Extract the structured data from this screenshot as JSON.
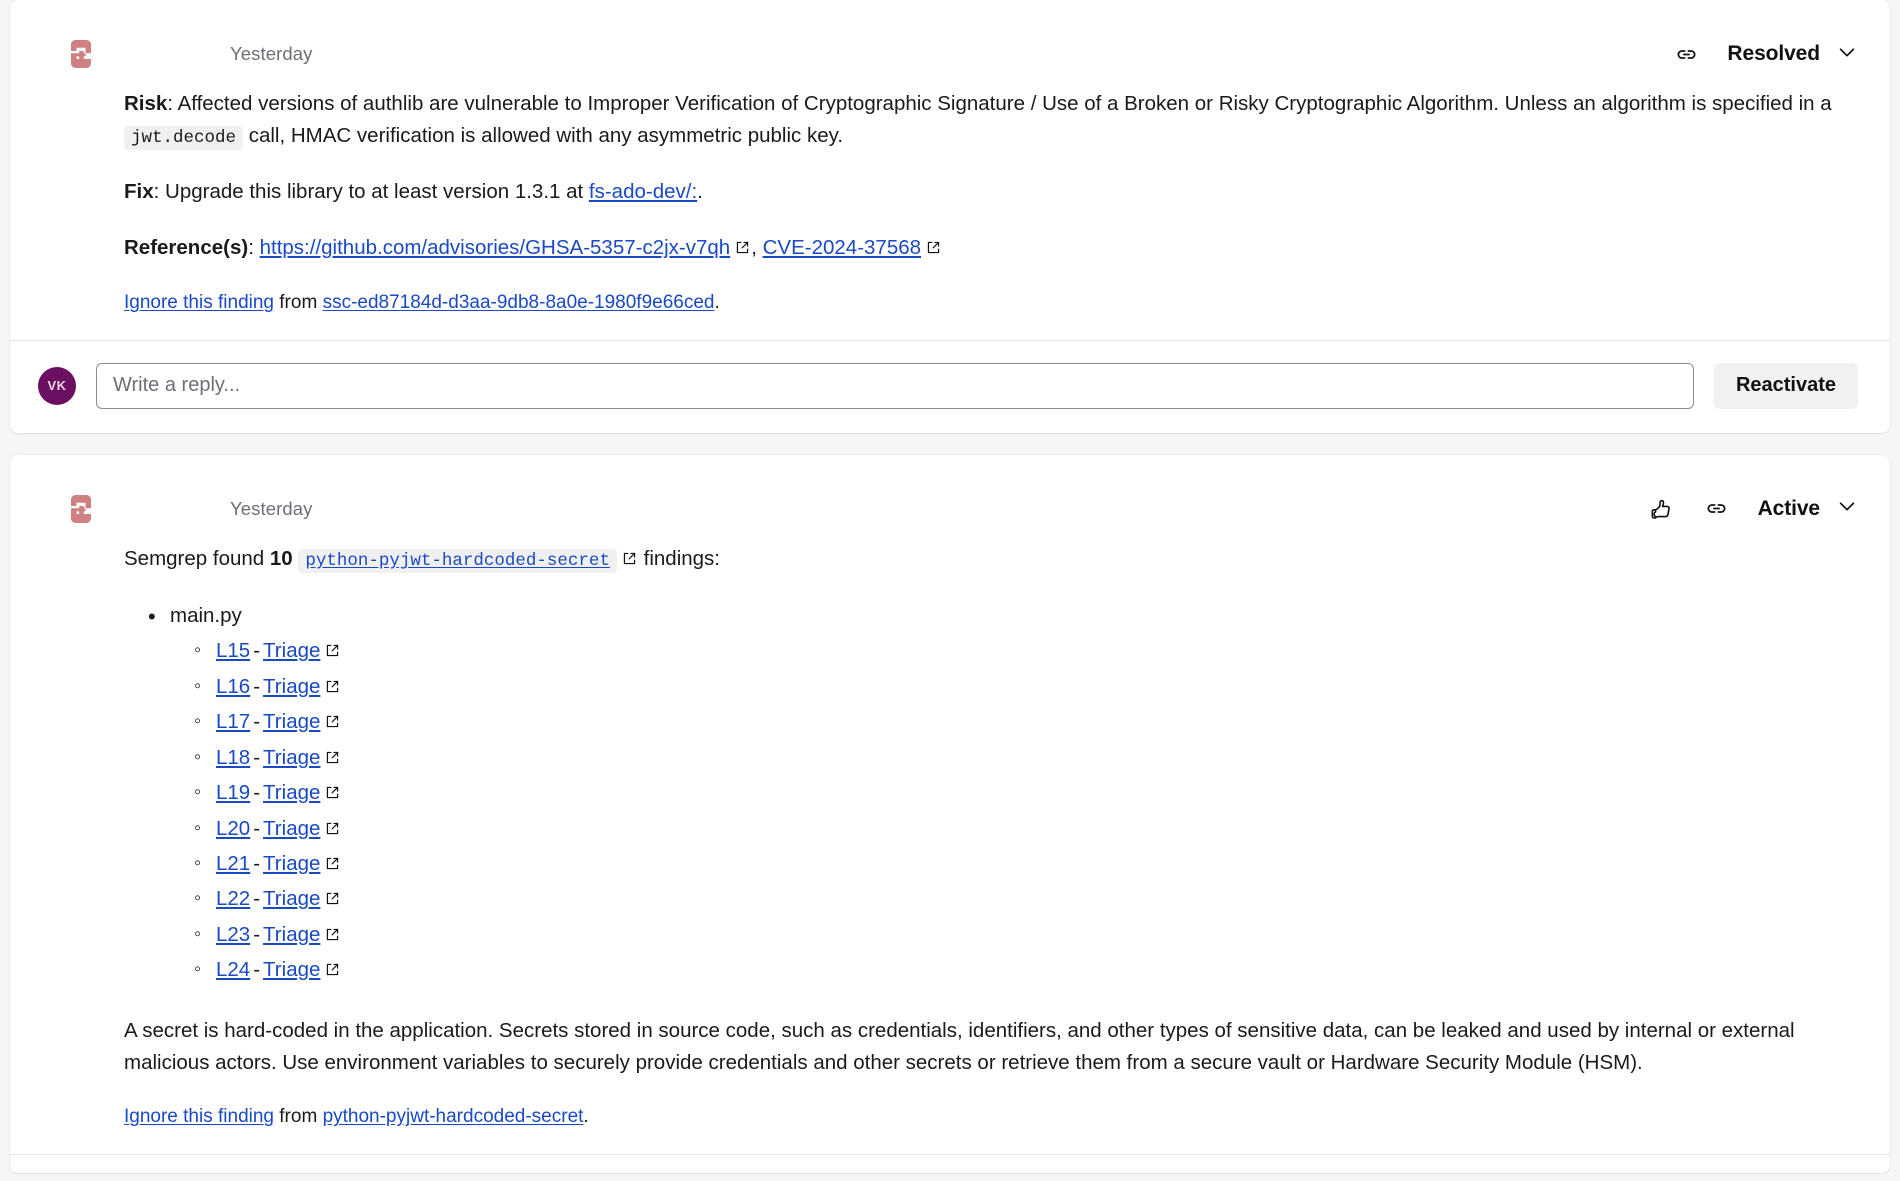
{
  "theme": {
    "page_bg": "#f6f6f7",
    "card_bg": "#ffffff",
    "link_color": "#1a49c4",
    "semgrep_avatar_color": "#cf8080",
    "user_avatar_color": "#6b1060",
    "button_bg": "#f1f1f2"
  },
  "comments": [
    {
      "avatar_icon": "semgrep-logo-icon",
      "timestamp": "Yesterday",
      "actions": {
        "link_icon": "link-icon",
        "status_label": "Resolved",
        "chevron_icon": "chevron-down-icon"
      },
      "risk": {
        "label": "Risk",
        "text_before_code": ": Affected versions of authlib are vulnerable to Improper Verification of Cryptographic Signature / Use of a Broken or Risky Cryptographic Algorithm. Unless an algorithm is specified in a ",
        "code": "jwt.decode",
        "text_after_code": " call, HMAC verification is allowed with any asymmetric public key."
      },
      "fix": {
        "label": "Fix",
        "text": ": Upgrade this library to at least version 1.3.1 at ",
        "link_text": "fs-ado-dev/:",
        "trailing": "."
      },
      "references": {
        "label": "Reference(s)",
        "separator": ": ",
        "links": [
          {
            "text": "https://github.com/advisories/GHSA-5357-c2jx-v7qh",
            "icon": "external-link-icon"
          },
          {
            "text": "CVE-2024-37568",
            "icon": "external-link-icon"
          }
        ],
        "comma": ", "
      },
      "ignore": {
        "link_text": "Ignore this finding",
        "middle": " from ",
        "source_text": "ssc-ed87184d-d3aa-9db8-8a0e-1980f9e66ced",
        "trailing": "."
      },
      "reply": {
        "avatar_initials": "VK",
        "placeholder": "Write a reply...",
        "value": "",
        "button_label": "Reactivate"
      }
    },
    {
      "avatar_icon": "semgrep-logo-icon",
      "timestamp": "Yesterday",
      "actions": {
        "thumbs_up_icon": "thumbs-up-icon",
        "link_icon": "link-icon",
        "status_label": "Active",
        "chevron_icon": "chevron-down-icon"
      },
      "summary": {
        "prefix": "Semgrep found ",
        "count": "10",
        "rule": "python-pyjwt-hardcoded-secret",
        "rule_icon": "external-link-icon",
        "suffix": " findings:"
      },
      "findings": [
        {
          "file": "main.py",
          "lines": [
            {
              "line": "L15",
              "action": "Triage",
              "icon": "external-link-icon"
            },
            {
              "line": "L16",
              "action": "Triage",
              "icon": "external-link-icon"
            },
            {
              "line": "L17",
              "action": "Triage",
              "icon": "external-link-icon"
            },
            {
              "line": "L18",
              "action": "Triage",
              "icon": "external-link-icon"
            },
            {
              "line": "L19",
              "action": "Triage",
              "icon": "external-link-icon"
            },
            {
              "line": "L20",
              "action": "Triage",
              "icon": "external-link-icon"
            },
            {
              "line": "L21",
              "action": "Triage",
              "icon": "external-link-icon"
            },
            {
              "line": "L22",
              "action": "Triage",
              "icon": "external-link-icon"
            },
            {
              "line": "L23",
              "action": "Triage",
              "icon": "external-link-icon"
            },
            {
              "line": "L24",
              "action": "Triage",
              "icon": "external-link-icon"
            }
          ]
        }
      ],
      "description": "A secret is hard-coded in the application. Secrets stored in source code, such as credentials, identifiers, and other types of sensitive data, can be leaked and used by internal or external malicious actors. Use environment variables to securely provide credentials and other secrets or retrieve them from a secure vault or Hardware Security Module (HSM).",
      "ignore": {
        "link_text": "Ignore this finding",
        "middle": " from ",
        "source_text": "python-pyjwt-hardcoded-secret",
        "trailing": "."
      }
    }
  ]
}
